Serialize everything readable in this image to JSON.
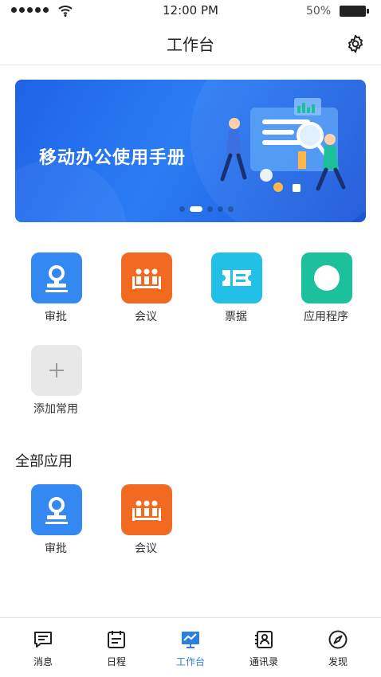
{
  "status": {
    "time": "12:00 PM",
    "battery": "50%"
  },
  "nav": {
    "title": "工作台"
  },
  "banner": {
    "headline": "移动办公使用手册",
    "slides": 5,
    "active_slide": 2
  },
  "common_apps": [
    {
      "label": "审批",
      "color": "#3388f2"
    },
    {
      "label": "会议",
      "color": "#f26a22"
    },
    {
      "label": "票据",
      "color": "#22bfe6"
    },
    {
      "label": "应用程序",
      "color": "#1cc09a"
    },
    {
      "label": "添加常用",
      "color": "#e8e8e8"
    }
  ],
  "section": {
    "title": "全部应用"
  },
  "all_apps": [
    {
      "label": "审批",
      "color": "#3388f2"
    },
    {
      "label": "会议",
      "color": "#f26a22"
    }
  ],
  "tabs": [
    {
      "label": "消息"
    },
    {
      "label": "日程"
    },
    {
      "label": "工作台"
    },
    {
      "label": "通讯录"
    },
    {
      "label": "发现"
    }
  ],
  "accent": "#2a7fe0"
}
